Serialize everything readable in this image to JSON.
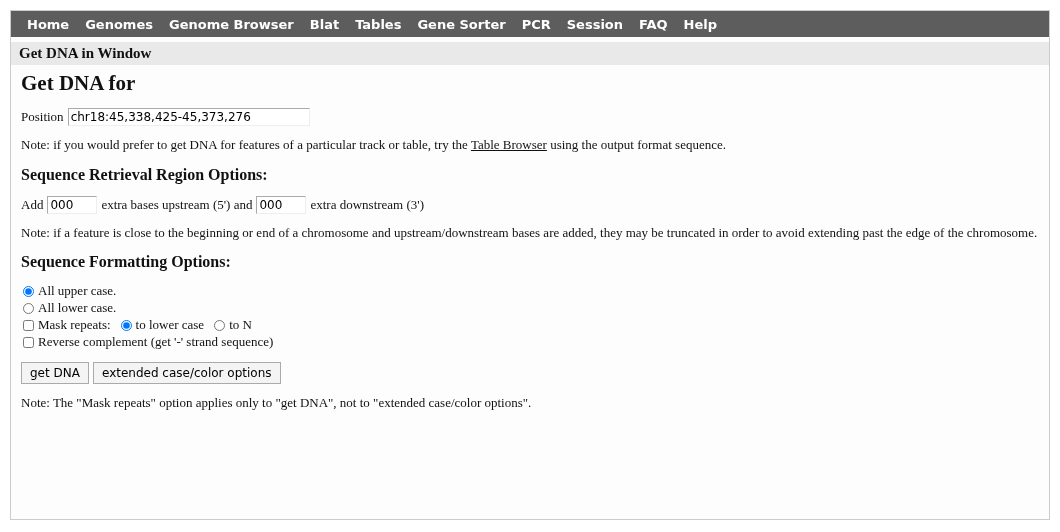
{
  "nav": [
    {
      "label": "Home"
    },
    {
      "label": "Genomes"
    },
    {
      "label": "Genome Browser"
    },
    {
      "label": "Blat"
    },
    {
      "label": "Tables"
    },
    {
      "label": "Gene Sorter"
    },
    {
      "label": "PCR"
    },
    {
      "label": "Session"
    },
    {
      "label": "FAQ"
    },
    {
      "label": "Help"
    }
  ],
  "panel_title": "Get DNA in Window",
  "heading": "Get DNA for",
  "position": {
    "label": "Position",
    "value": "chr18:45,338,425-45,373,276"
  },
  "table_note": {
    "before": "Note: if you would prefer to get DNA for features of a particular track or table, try the",
    "link": "Table Browser",
    "after": "using the output format sequence."
  },
  "region_section": {
    "title": "Sequence Retrieval Region Options:",
    "add_label": "Add",
    "upstream_value": "000",
    "upstream_label": "extra bases upstream (5') and",
    "downstream_value": "000",
    "downstream_label": "extra downstream (3')",
    "note": "Note: if a feature is close to the beginning or end of a chromosome and upstream/downstream bases are added, they may be truncated in order to avoid extending past the edge of the chromosome."
  },
  "format_section": {
    "title": "Sequence Formatting Options:",
    "case_options": [
      {
        "label": "All upper case.",
        "selected": true
      },
      {
        "label": "All lower case.",
        "selected": false
      }
    ],
    "mask_repeats": {
      "label": "Mask repeats:",
      "checked": false,
      "options": [
        {
          "label": "to lower case",
          "selected": true
        },
        {
          "label": "to N",
          "selected": false
        }
      ]
    },
    "reverse_complement": {
      "label": "Reverse complement (get '-' strand sequence)",
      "checked": false
    }
  },
  "buttons": [
    {
      "label": "get DNA"
    },
    {
      "label": "extended case/color options"
    }
  ],
  "footer_note": "Note: The \"Mask repeats\" option applies only to \"get DNA\", not to \"extended case/color options\"."
}
